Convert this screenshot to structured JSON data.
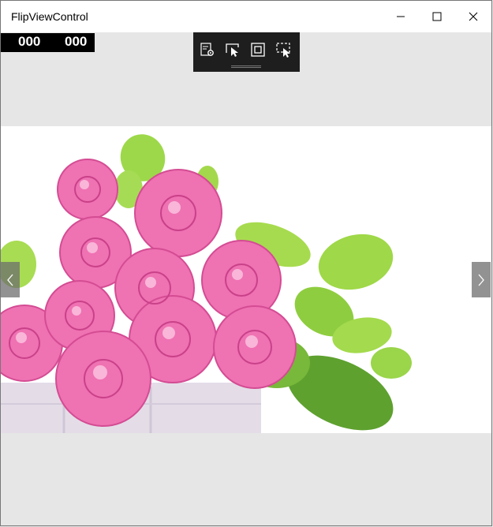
{
  "window": {
    "title": "FlipViewControl",
    "caption_buttons": [
      "minimize-icon",
      "maximize-icon",
      "close-icon"
    ]
  },
  "counters": [
    "000",
    "000"
  ],
  "debug_toolbar": {
    "icons": [
      "live-visual-tree-icon",
      "select-element-icon",
      "display-layout-adorners-icon",
      "track-focus-icon"
    ]
  },
  "flipview": {
    "image": "pink roses with green leaves in a white basket",
    "nav_icons": [
      "chevron-left-icon",
      "chevron-right-icon"
    ]
  },
  "colors": {
    "background": "#e6e6e6",
    "toolbar": "#1e1e1e",
    "rose": "#ee6fb0",
    "leaf": "#8fd33a"
  }
}
